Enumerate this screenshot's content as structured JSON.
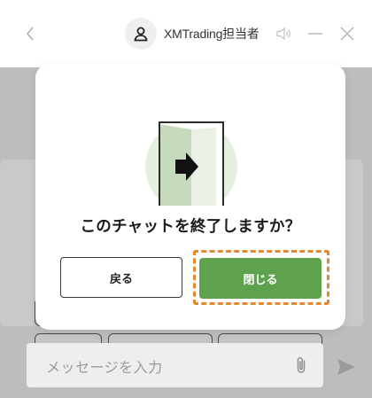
{
  "header": {
    "back_icon": "chevron-left-icon",
    "agent_name": "XMTrading担当者",
    "avatar_icon": "user-icon",
    "controls": [
      "speaker-icon",
      "minimize-icon",
      "close-icon"
    ]
  },
  "dialog": {
    "illustration": "exit-door-icon",
    "title": "このチャットを終了しますか？",
    "back_label": "戻る",
    "close_label": "閉じる",
    "close_highlight_color": "#e38a2e",
    "close_button_color": "#5fa24e"
  },
  "composer": {
    "placeholder": "メッセージを入力",
    "attach_icon": "paperclip-icon",
    "send_icon": "send-icon"
  }
}
